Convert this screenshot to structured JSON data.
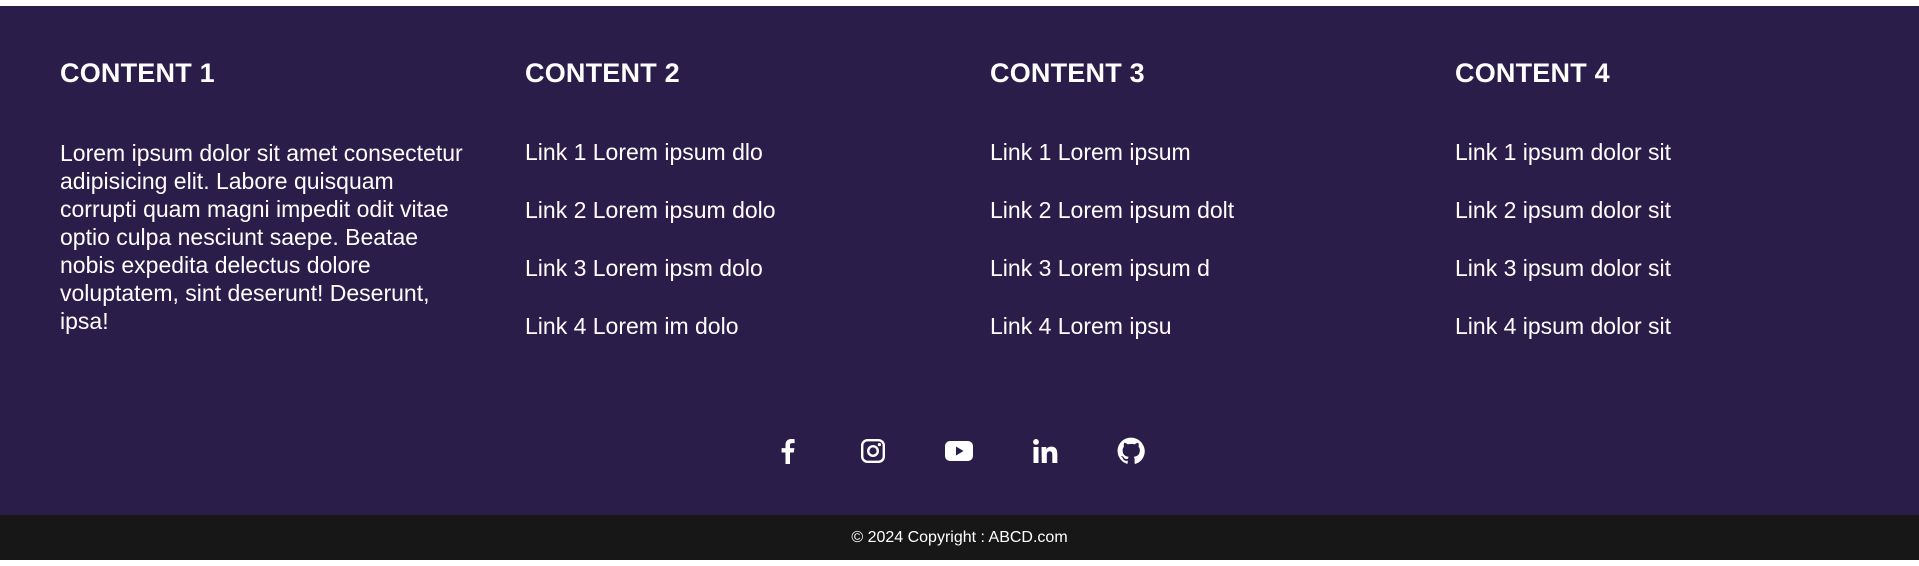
{
  "colors": {
    "footer_bg": "#2a1d4a",
    "copyright_bg": "#171717",
    "text": "#ffffff"
  },
  "footer": {
    "columns": [
      {
        "title": "CONTENT 1",
        "text": "Lorem ipsum dolor sit amet consectetur adipisicing elit. Labore quisquam corrupti quam magni impedit odit vitae optio culpa nesciunt saepe. Beatae nobis expedita delectus dolore voluptatem, sint deserunt! Deserunt, ipsa!"
      },
      {
        "title": "CONTENT 2",
        "links": [
          "Link 1 Lorem ipsum dlo",
          "Link 2 Lorem ipsum dolo",
          "Link 3 Lorem ipsm dolo",
          "Link 4 Lorem im dolo"
        ]
      },
      {
        "title": "CONTENT 3",
        "links": [
          "Link 1 Lorem ipsum",
          "Link 2 Lorem ipsum dolt",
          "Link 3 Lorem ipsum d",
          "Link 4 Lorem ipsu"
        ]
      },
      {
        "title": "CONTENT 4",
        "links": [
          "Link 1 ipsum dolor sit",
          "Link 2 ipsum dolor sit",
          "Link 3 ipsum dolor sit",
          "Link 4 ipsum dolor sit"
        ]
      }
    ],
    "social": [
      "facebook-icon",
      "instagram-icon",
      "youtube-icon",
      "linkedin-icon",
      "github-icon"
    ]
  },
  "copyright": {
    "text": "© 2024 Copyright : ABCD.com"
  }
}
